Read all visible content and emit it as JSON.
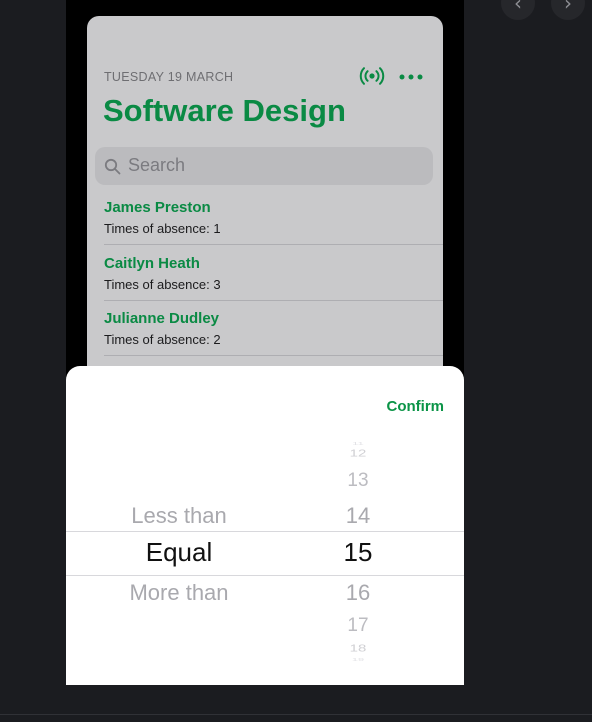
{
  "nav": {
    "prev_glyph": "‹",
    "next_glyph": "›"
  },
  "header": {
    "date": "TUESDAY 19 MARCH",
    "title": "Software Design",
    "icons": [
      "broadcast-icon",
      "more-icon"
    ]
  },
  "search": {
    "placeholder": "Search",
    "icon": "search-icon"
  },
  "students": [
    {
      "name": "James Preston",
      "subtitle": "Times of absence: 1"
    },
    {
      "name": "Caitlyn Heath",
      "subtitle": "Times of absence: 3"
    },
    {
      "name": "Julianne Dudley",
      "subtitle": "Times of absence: 2"
    }
  ],
  "picker": {
    "confirm_label": "Confirm",
    "comparison": {
      "above": "Less than",
      "selected": "Equal",
      "below": "More than"
    },
    "number": {
      "above": [
        "11",
        "12",
        "13",
        "14"
      ],
      "selected": "15",
      "below": [
        "16",
        "17",
        "18",
        "19"
      ]
    }
  },
  "colors": {
    "accent": "#0a8a44",
    "confirm": "#0b9447",
    "background": "#1b1c20",
    "sheet_dimmed": "#c9c9cb"
  }
}
